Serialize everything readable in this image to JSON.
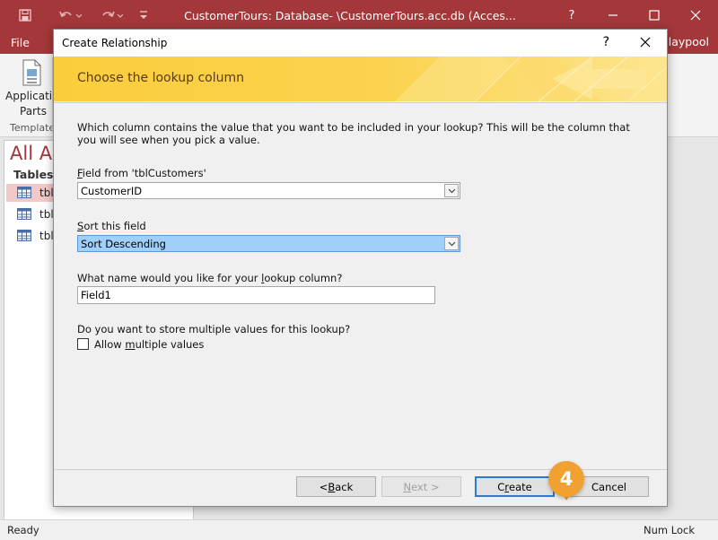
{
  "app": {
    "title": "CustomerTours: Database- \\CustomerTours.acc.db (Acces...",
    "help_glyph": "?",
    "file_tab": "File",
    "user": "Claypool"
  },
  "ribbon": {
    "button_label_line1": "Application",
    "button_label_line2": "Parts",
    "group_label": "Template"
  },
  "nav": {
    "title": "All Ac",
    "section": "Tables",
    "items": [
      {
        "label": "tbl"
      },
      {
        "label": "tbl"
      },
      {
        "label": "tbl"
      }
    ]
  },
  "status": {
    "left": "Ready",
    "right": "Num Lock"
  },
  "dialog": {
    "title": "Create Relationship",
    "help": "?",
    "banner": "Choose the lookup column",
    "question": "Which column contains the value that you want to be included in your lookup?  This will be the column that you will see when you pick a value.",
    "field_label_accel": "F",
    "field_label_rest": "ield from 'tblCustomers'",
    "field_value": "CustomerID",
    "sort_label_accel": "S",
    "sort_label_rest": "ort this field",
    "sort_value": "Sort Descending",
    "name_label_pre": "What name would you like for your ",
    "name_label_accel": "l",
    "name_label_post": "ookup column?",
    "name_value": "Field1",
    "multi_question": "Do you want to store multiple values for this lookup?",
    "allow_pre": "Allow ",
    "allow_accel": "m",
    "allow_post": "ultiple values",
    "allow_checked": false,
    "buttons": {
      "back_pre": "< ",
      "back_accel": "B",
      "back_post": "ack",
      "next_accel": "N",
      "next_post": "ext >",
      "create_pre": "C",
      "create_accel": "r",
      "create_post": "eate",
      "cancel": "Cancel"
    }
  },
  "callout": {
    "step": "4",
    "color": "#f0a130"
  },
  "colors": {
    "access_brand": "#a4373a",
    "banner": "#fbcd3c",
    "selection": "#9fd0f8",
    "nav_selection": "#f2c8c8"
  },
  "icons": [
    "save-icon",
    "undo-icon",
    "redo-icon",
    "customize-icon",
    "minimize-icon",
    "restore-icon",
    "close-icon",
    "application-parts-icon",
    "table-icon",
    "chevron-down-icon"
  ]
}
